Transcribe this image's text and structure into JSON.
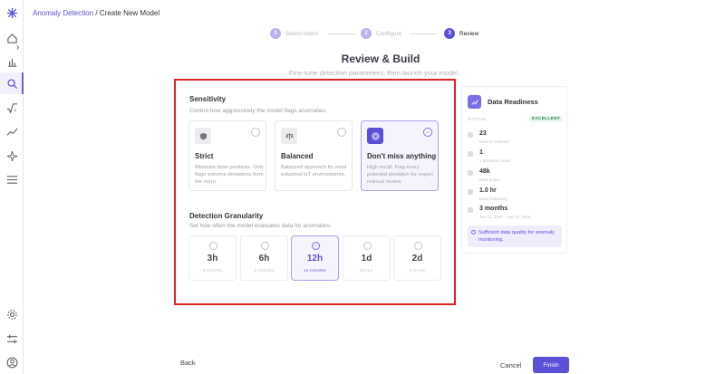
{
  "breadcrumb": {
    "parent": "Anomaly Detection",
    "separator": "/",
    "current": "Create New Model"
  },
  "stepper": [
    {
      "num": "1",
      "label": "Select Intent"
    },
    {
      "num": "2",
      "label": "Configure"
    },
    {
      "num": "3",
      "label": "Review"
    }
  ],
  "header": {
    "title": "Review & Build",
    "subtitle": "Fine-tune detection parameters, then launch your model."
  },
  "sensitivity": {
    "title": "Sensitivity",
    "desc": "Control how aggressively the model flags anomalies.",
    "options": [
      {
        "name": "Strict",
        "desc": "Minimize false positives. Only flags extreme deviations from the norm.",
        "icon": "shield-icon"
      },
      {
        "name": "Balanced",
        "desc": "Balanced approach for most industrial IoT environments.",
        "icon": "scale-icon"
      },
      {
        "name": "Don't miss anything",
        "desc": "High recall. Flag every potential deviation for expert manual review.",
        "icon": "target-icon",
        "selected": true,
        "check": "✓"
      }
    ]
  },
  "granularity": {
    "title": "Detection Granularity",
    "desc": "Set how often the model evaluates data for anomalies.",
    "options": [
      {
        "value": "3h",
        "sub": "3 HOURS"
      },
      {
        "value": "6h",
        "sub": "6 HOURS"
      },
      {
        "value": "12h",
        "sub": "12 HOURS",
        "selected": true,
        "check": "✓"
      },
      {
        "value": "1d",
        "sub": "DAILY"
      },
      {
        "value": "2d",
        "sub": "2 DAYS"
      }
    ]
  },
  "readiness": {
    "title": "Data Readiness",
    "status_label": "STATUS",
    "status": "EXCELLENT",
    "rows": [
      {
        "value": "23",
        "label": "Data-to selected"
      },
      {
        "value": "1",
        "label": "1 dormitory basis"
      },
      {
        "value": "48k",
        "label": "Data points"
      },
      {
        "value": "1.0 hr",
        "label": "Data frequency"
      },
      {
        "value": "3 months",
        "label": "Jan 11, 2025 – Apr 10, 2025"
      }
    ],
    "note": "Sufficient data quality for anomaly monitoring."
  },
  "footer": {
    "back": "Back",
    "cancel": "Cancel",
    "finish": "Finish"
  },
  "colors": {
    "accent": "#5b50d6",
    "highlight": "#e02424",
    "success": "#2c8a4a"
  }
}
